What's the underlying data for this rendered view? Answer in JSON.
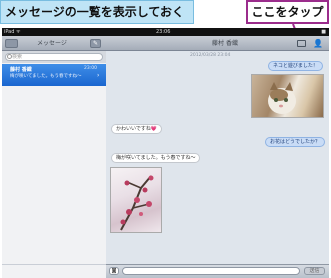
{
  "callouts": {
    "left": "メッセージの一覧を表示しておく",
    "right": "ここをタップ"
  },
  "statusbar": {
    "carrier": "iPad ᯤ",
    "time": "23:06",
    "battery": "■"
  },
  "left_pane": {
    "title": "メッセージ",
    "search_placeholder": "検索",
    "conversation": {
      "name": "藤村 香織",
      "time": "23:00",
      "preview": "梅が咲いてました。もう春ですね〜"
    }
  },
  "right_pane": {
    "title": "藤村 香織",
    "date": "2012/03/28 23:04",
    "messages": [
      {
        "dir": "out",
        "text": "ネコと遊びました！"
      },
      {
        "dir": "in",
        "text": "かわいいですね💗"
      },
      {
        "dir": "out",
        "text": "お花はどうでしたか？"
      },
      {
        "dir": "in",
        "text": "梅が咲いてました。もう春ですね〜"
      }
    ],
    "send_label": "送信",
    "camera_label": "◙"
  },
  "colors": {
    "accent": "#1a66cf",
    "callout_border": "#9b2c8c"
  }
}
